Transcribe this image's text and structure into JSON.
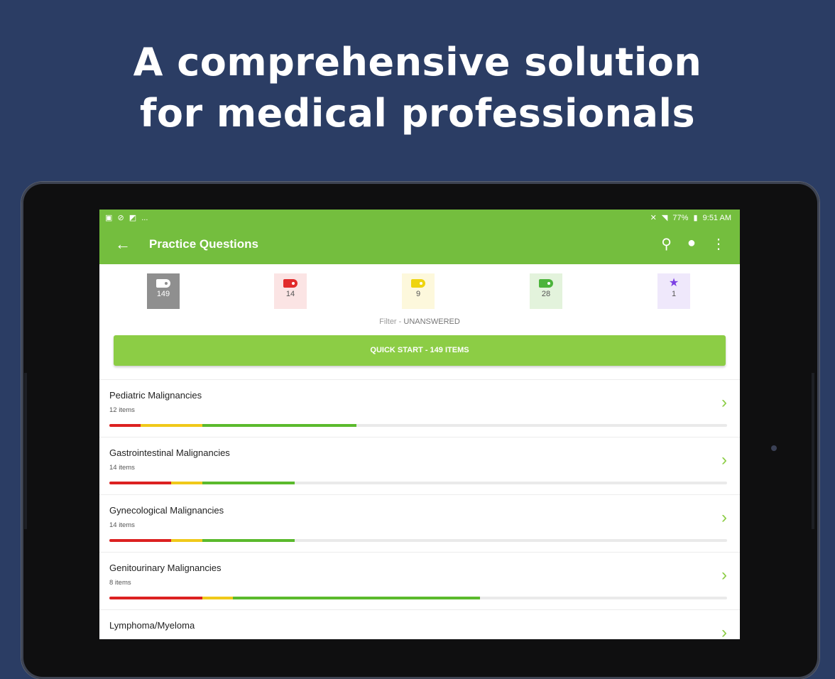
{
  "headline": {
    "line1": "A comprehensive solution",
    "line2": "for medical professionals"
  },
  "statusbar": {
    "left_icons": [
      "image-icon",
      "block-icon",
      "flag-icon",
      "more-icon"
    ],
    "left_text": "...",
    "battery": "77%",
    "time": "9:51 AM"
  },
  "appbar": {
    "back_glyph": "←",
    "title": "Practice Questions",
    "search_glyph": "⚲",
    "profile_glyph": "●",
    "menu_glyph": "⋮"
  },
  "filters": {
    "all": "149",
    "red": "14",
    "yellow": "9",
    "green": "28",
    "starred": "1",
    "star_glyph": "★"
  },
  "filter_label": "Filter - ",
  "filter_value": "UNANSWERED",
  "quick_start_label": "QUICK START - 149 ITEMS",
  "chevron_glyph": "›",
  "topics": [
    {
      "name": "Pediatric Malignancies",
      "count": "12 items",
      "red": 0.05,
      "yellow": 0.1,
      "green": 0.25
    },
    {
      "name": "Gastrointestinal Malignancies",
      "count": "14 items",
      "red": 0.1,
      "yellow": 0.05,
      "green": 0.15
    },
    {
      "name": "Gynecological Malignancies",
      "count": "14 items",
      "red": 0.1,
      "yellow": 0.05,
      "green": 0.15
    },
    {
      "name": "Genitourinary Malignancies",
      "count": "8 items",
      "red": 0.15,
      "yellow": 0.05,
      "green": 0.4
    },
    {
      "name": "Lymphoma/Myeloma",
      "count": "",
      "red": 0,
      "yellow": 0,
      "green": 0
    }
  ],
  "colors": {
    "background": "#2b3d64",
    "appbar": "#74be3e",
    "quick_start": "#8ccd45",
    "red": "#dc2121",
    "yellow": "#f0c91a",
    "green": "#5bba2d",
    "star": "#7b3fe4"
  }
}
